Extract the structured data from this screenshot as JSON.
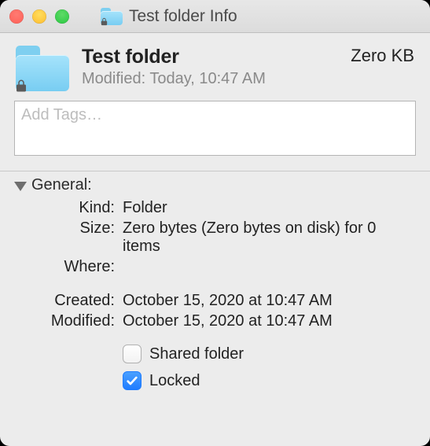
{
  "window": {
    "title": "Test folder Info"
  },
  "header": {
    "name": "Test folder",
    "size": "Zero KB",
    "modified_label": "Modified:",
    "modified_value": "Today, 10:47 AM"
  },
  "tags": {
    "placeholder": "Add Tags…",
    "value": ""
  },
  "sections": {
    "general": {
      "heading": "General:",
      "kind_label": "Kind:",
      "kind_value": "Folder",
      "size_label": "Size:",
      "size_value": "Zero bytes (Zero bytes on disk) for 0 items",
      "where_label": "Where:",
      "where_value": "",
      "created_label": "Created:",
      "created_value": "October 15, 2020 at 10:47 AM",
      "modified_label": "Modified:",
      "modified_value": "October 15, 2020 at 10:47 AM",
      "shared_label": "Shared folder",
      "shared_checked": false,
      "locked_label": "Locked",
      "locked_checked": true
    }
  }
}
